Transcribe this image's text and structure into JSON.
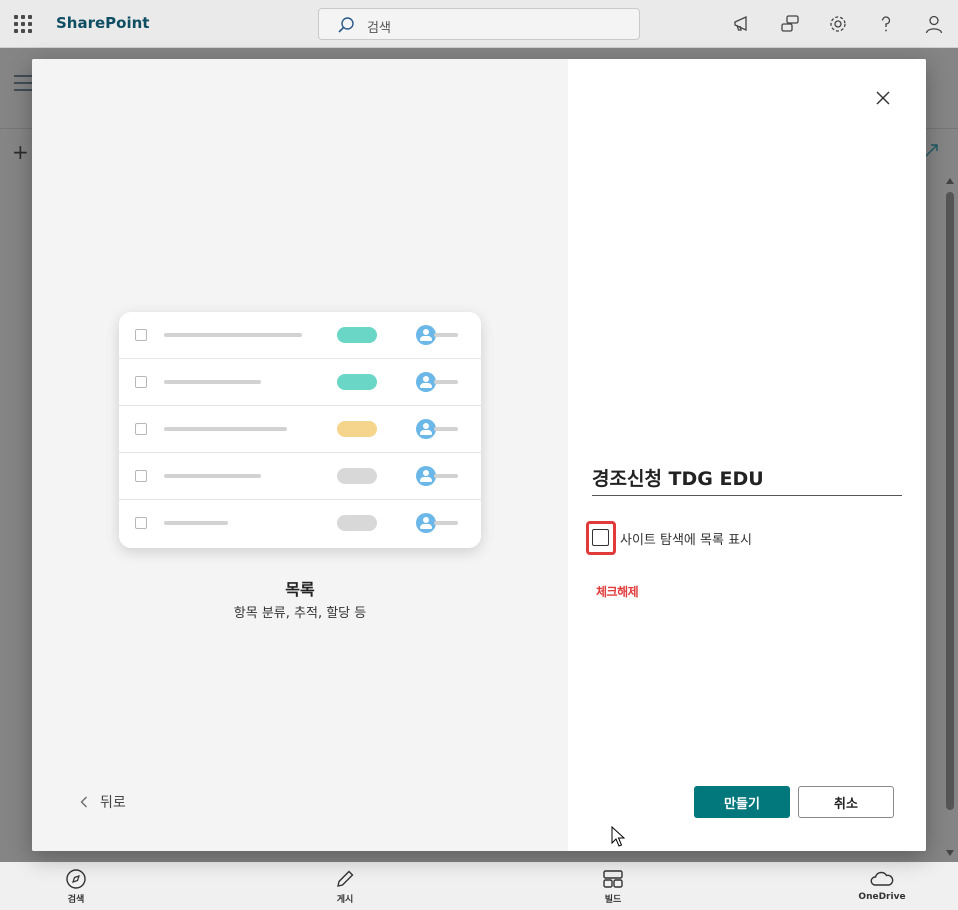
{
  "suite_bar": {
    "brand": "SharePoint",
    "search_placeholder": "검색"
  },
  "colors": {
    "accent": "#03787c",
    "brand_text": "#0f4d63",
    "annotation": "#e03a3a"
  },
  "dialog": {
    "template_preview": {
      "rows": [
        {
          "pill_color": "#6ad6c6"
        },
        {
          "pill_color": "#6ad6c6"
        },
        {
          "pill_color": "#f5d58c"
        },
        {
          "pill_color": "#d8d8d8"
        },
        {
          "pill_color": "#d8d8d8"
        }
      ]
    },
    "template_title": "목록",
    "template_description": "항목 분류, 추적, 할당 등",
    "back_label": "뒤로",
    "name_value": "경조신청 TDG EDU",
    "show_in_nav_label": "사이트 탐색에 목록 표시",
    "show_in_nav_checked": false,
    "annotation": "체크해제",
    "create_label": "만들기",
    "cancel_label": "취소"
  },
  "app_bar": {
    "items": [
      {
        "label": "검색",
        "icon": "compass-icon"
      },
      {
        "label": "게시",
        "icon": "pencil-icon"
      },
      {
        "label": "빌드",
        "icon": "grid-icon"
      },
      {
        "label": "OneDrive",
        "icon": "cloud-icon"
      }
    ]
  }
}
